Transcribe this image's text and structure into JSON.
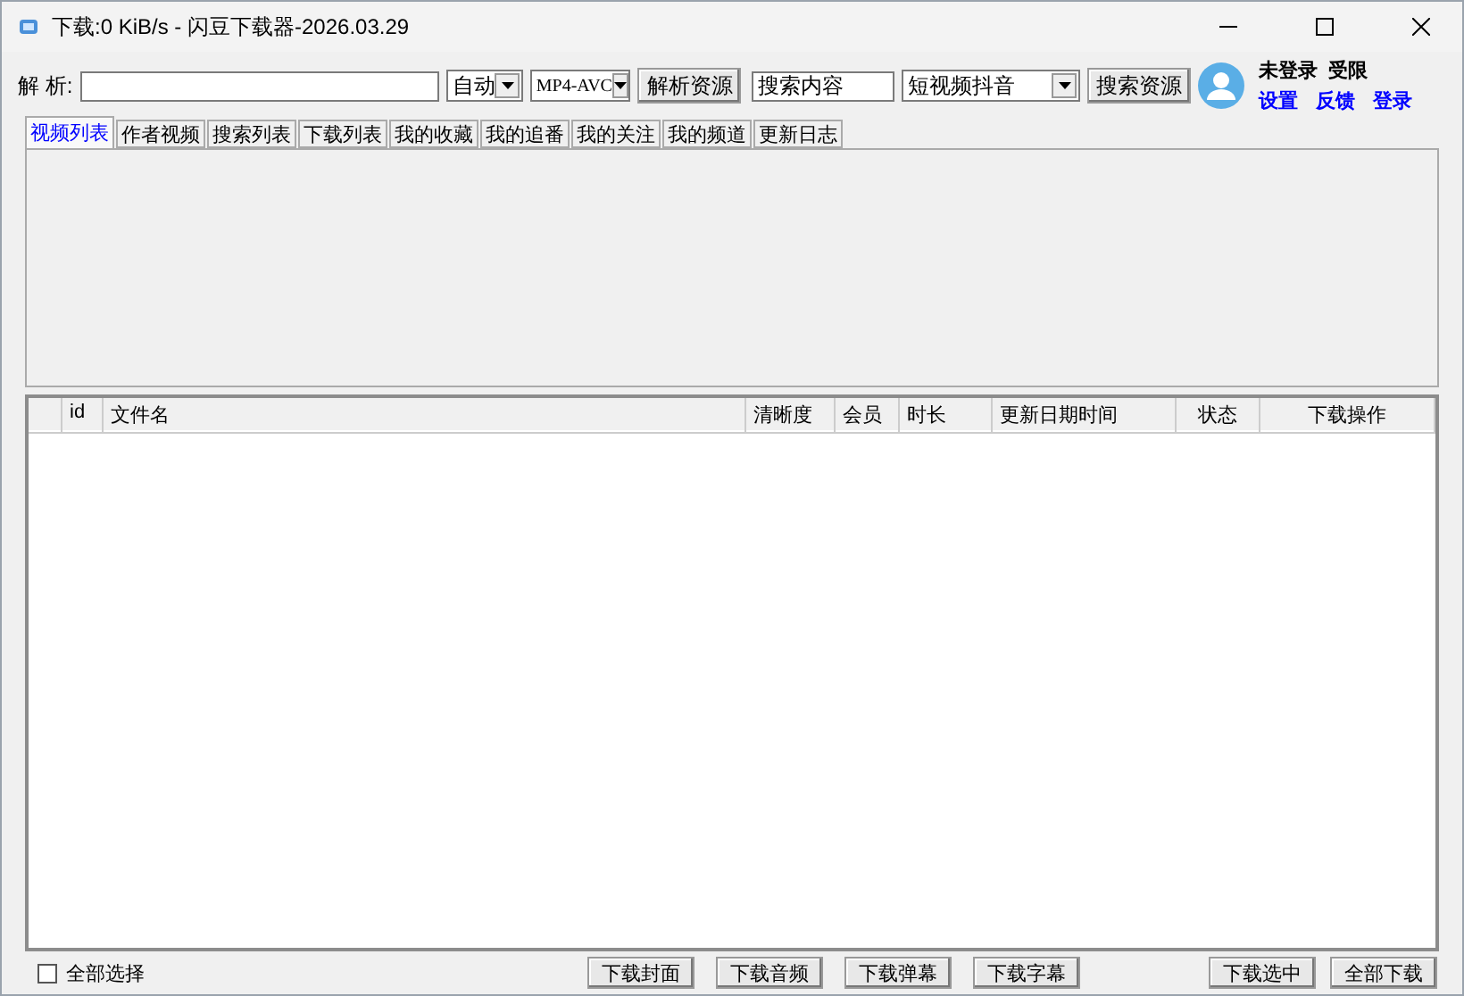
{
  "window": {
    "title": "下载:0 KiB/s - 闪豆下载器-2026.03.29"
  },
  "parse_bar": {
    "label": "解 析:",
    "quality": {
      "value": "自动"
    },
    "format": {
      "value": "MP4-AVC"
    },
    "parse_button": "解析资源"
  },
  "search_bar": {
    "search_field": {
      "value": "搜索内容"
    },
    "source": {
      "value": "短视频抖音"
    },
    "search_button": "搜索资源"
  },
  "account": {
    "status": "未登录",
    "limit": "受限",
    "links": [
      "设置",
      "反馈",
      "登录"
    ]
  },
  "tabs": [
    {
      "label": "视频列表",
      "selected": true
    },
    {
      "label": "作者视频",
      "selected": false
    },
    {
      "label": "搜索列表",
      "selected": false
    },
    {
      "label": "下载列表",
      "selected": false
    },
    {
      "label": "我的收藏",
      "selected": false
    },
    {
      "label": "我的追番",
      "selected": false
    },
    {
      "label": "我的关注",
      "selected": false
    },
    {
      "label": "我的频道",
      "selected": false
    },
    {
      "label": "更新日志",
      "selected": false
    }
  ],
  "table": {
    "columns": [
      "id",
      "文件名",
      "清晰度",
      "会员",
      "时长",
      "更新日期时间",
      "状态",
      "下载操作"
    ]
  },
  "footer": {
    "select_all": {
      "label": "全部选择",
      "checked": false
    },
    "buttons": [
      "下载封面",
      "下载音频",
      "下载弹幕",
      "下载字幕",
      "下载选中",
      "全部下载"
    ]
  }
}
